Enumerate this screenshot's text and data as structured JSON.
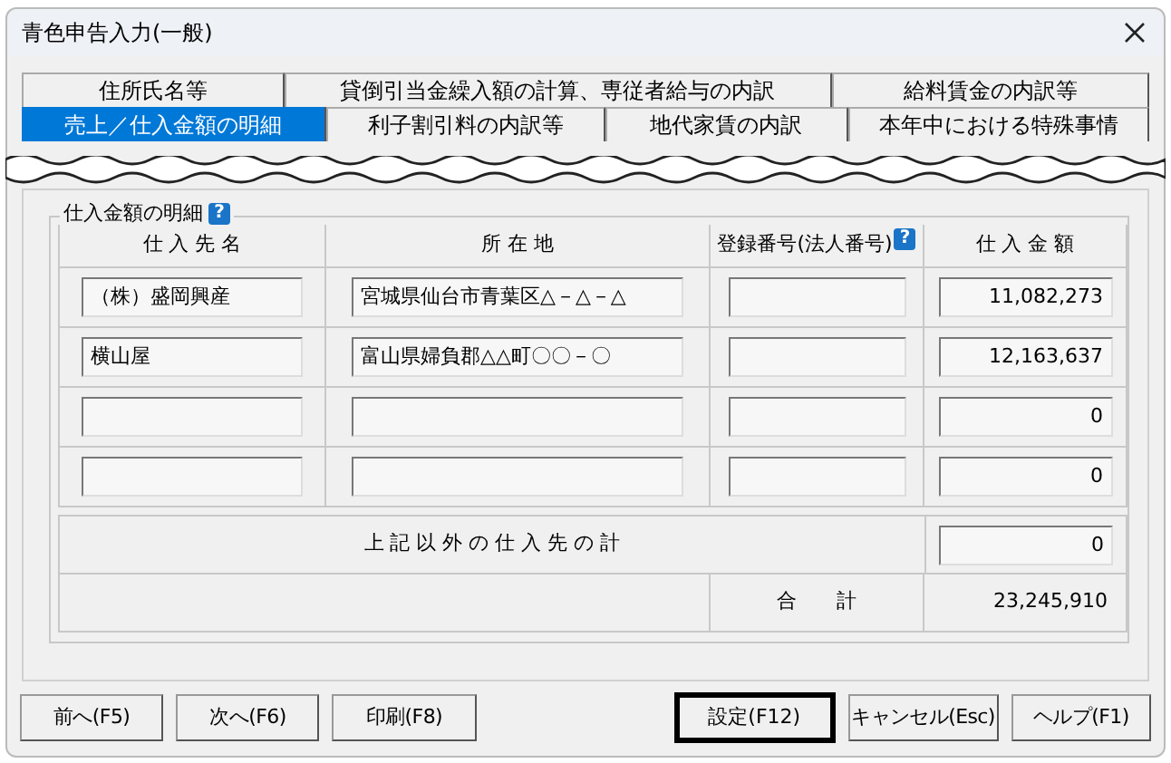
{
  "window": {
    "title": "青色申告入力(一般)"
  },
  "tab_rows": [
    [
      {
        "label": "住所氏名等",
        "selected": false
      },
      {
        "label": "貸倒引当金繰入額の計算、専従者給与の内訳",
        "selected": false
      },
      {
        "label": "給料賃金の内訳等",
        "selected": false
      }
    ],
    [
      {
        "label": "売上／仕入金額の明細",
        "selected": true
      },
      {
        "label": "利子割引料の内訳等",
        "selected": false
      },
      {
        "label": "地代家賃の内訳",
        "selected": false
      },
      {
        "label": "本年中における特殊事情",
        "selected": false
      }
    ]
  ],
  "group": {
    "title": "仕入金額の明細",
    "help": "?"
  },
  "columns": [
    {
      "label": "仕 入 先 名"
    },
    {
      "label": "所 在 地"
    },
    {
      "label": "登録番号(法人番号)",
      "help": "?"
    },
    {
      "label": "仕 入 金 額"
    }
  ],
  "rows": [
    {
      "name": "（株）盛岡興産",
      "address": "宮城県仙台市青葉区△－△－△",
      "amount": "11,082,273"
    },
    {
      "name": "横山屋",
      "address": "富山県婦負郡△△町〇〇－〇",
      "amount": "12,163,637"
    },
    {
      "amount": "0"
    },
    {
      "amount": "0"
    }
  ],
  "other_total": {
    "label": "上 記 以 外 の 仕 入 先 の 計",
    "value": "0"
  },
  "total": {
    "label": "合　　計",
    "value": "23,245,910"
  },
  "buttons": [
    {
      "label": "前へ(F5)",
      "focused": false
    },
    {
      "label": "次へ(F6)",
      "focused": false
    },
    {
      "label": "印刷(F8)",
      "focused": false
    },
    {
      "label": "設定(F12)",
      "focused": true
    },
    {
      "label": "キャンセル(Esc)",
      "focused": false
    },
    {
      "label": "ヘルプ(F1)",
      "focused": false
    }
  ]
}
